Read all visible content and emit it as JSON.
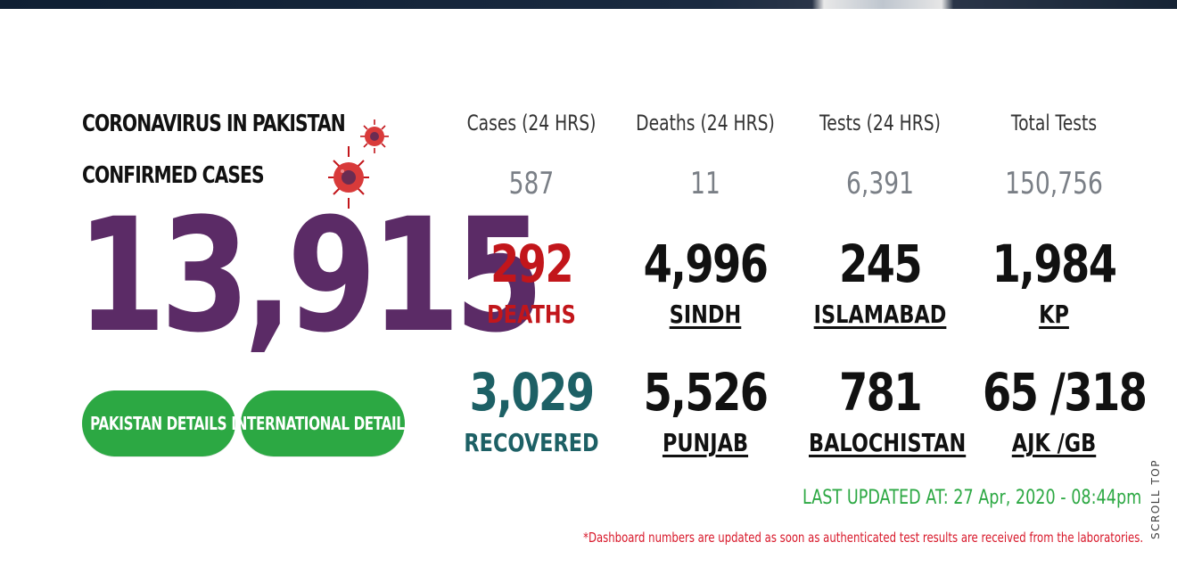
{
  "header": {
    "title_line1": "CORONAVIRUS IN PAKISTAN",
    "title_line2": "CONFIRMED CASES"
  },
  "confirmed_total": "13,915",
  "buttons": {
    "pakistan_details": "PAKISTAN DETAILS",
    "international_details": "INTERNATIONAL DETAILS"
  },
  "daily_stats": [
    {
      "label": "Cases (24 HRS)",
      "value": "587"
    },
    {
      "label": "Deaths (24 HRS)",
      "value": "11"
    },
    {
      "label": "Tests (24 HRS)",
      "value": "6,391"
    },
    {
      "label": "Total Tests",
      "value": "150,756"
    }
  ],
  "row1": [
    {
      "value": "292",
      "label": "DEATHS"
    },
    {
      "value": "4,996",
      "label": "SINDH"
    },
    {
      "value": "245",
      "label": "ISLAMABAD"
    },
    {
      "value": "1,984",
      "label": "KP"
    }
  ],
  "row2": [
    {
      "value": "3,029",
      "label": "RECOVERED"
    },
    {
      "value": "5,526",
      "label": "PUNJAB"
    },
    {
      "value": "781",
      "label": "BALOCHISTAN"
    },
    {
      "value": "65 /318",
      "label": "AJK /GB"
    }
  ],
  "last_updated": "LAST UPDATED AT: 27 Apr, 2020 - 08:44pm",
  "disclaimer": "*Dashboard numbers are updated as soon as authenticated test results are received from the laboratories.",
  "scroll_top_label": "SCROLL TOP",
  "colors": {
    "brand_purple": "#5b2b66",
    "button_green": "#2ca843",
    "death_red": "#c2161b",
    "recovered_teal": "#1d6065",
    "updated_green": "#2ca843",
    "note_red": "#d8182a"
  },
  "icons": [
    "virus-icon",
    "virus-icon-small"
  ]
}
